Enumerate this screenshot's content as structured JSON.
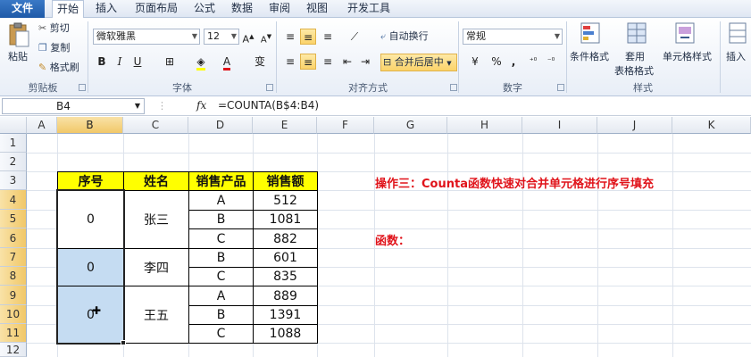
{
  "ribbon": {
    "tabs": [
      "文件",
      "开始",
      "插入",
      "页面布局",
      "公式",
      "数据",
      "审阅",
      "视图",
      "开发工具"
    ],
    "clipboard": {
      "paste": "粘贴",
      "cut": "剪切",
      "copy": "复制",
      "format_painter": "格式刷",
      "label": "剪贴板"
    },
    "font": {
      "name": "微软雅黑",
      "size": "12",
      "bold": "B",
      "italic": "I",
      "underline": "U",
      "phonetic": "变",
      "label": "字体"
    },
    "alignment": {
      "wrap": "自动换行",
      "merge": "合并后居中",
      "label": "对齐方式"
    },
    "number": {
      "format": "常规",
      "percent": "%",
      "comma": ",",
      "label": "数字"
    },
    "styles": {
      "conditional": "条件格式",
      "table1": "套用",
      "table2": "表格格式",
      "cell_styles": "单元格样式",
      "label": "样式"
    },
    "insert": {
      "label": "插入"
    }
  },
  "formula_bar": {
    "name_box": "B4",
    "fx": "fx",
    "formula": "=COUNTA(B$4:B4)"
  },
  "grid": {
    "columns": [
      "A",
      "B",
      "C",
      "D",
      "E",
      "F",
      "G",
      "H",
      "I",
      "J",
      "K"
    ],
    "rows": [
      "1",
      "2",
      "3",
      "4",
      "5",
      "6",
      "7",
      "8",
      "9",
      "10",
      "11",
      "12"
    ]
  },
  "table": {
    "headers": [
      "序号",
      "姓名",
      "销售产品",
      "销售额"
    ],
    "groups": [
      {
        "seq": "0",
        "name": "张三"
      },
      {
        "seq": "0",
        "name": "李四"
      },
      {
        "seq": "0",
        "name": "王五"
      }
    ],
    "rows": [
      {
        "product": "A",
        "amount": "512"
      },
      {
        "product": "B",
        "amount": "1081"
      },
      {
        "product": "C",
        "amount": "882"
      },
      {
        "product": "B",
        "amount": "601"
      },
      {
        "product": "C",
        "amount": "835"
      },
      {
        "product": "A",
        "amount": "889"
      },
      {
        "product": "B",
        "amount": "1391"
      },
      {
        "product": "C",
        "amount": "1088"
      }
    ]
  },
  "notes": {
    "operation": "操作三：Counta函数快速对合并单元格进行序号填充",
    "function": "函数："
  }
}
